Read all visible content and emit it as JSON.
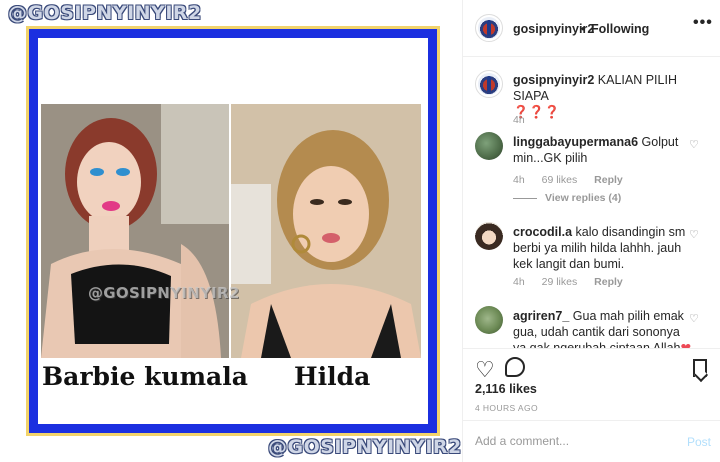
{
  "image": {
    "watermark_top": "@GOSIPNYINYIR2",
    "watermark_bottom": "@GOSIPNYINYIR2",
    "photo_watermark": "@GOSIPNYINYIR2",
    "left_label": "Barbie kumala",
    "right_label": "Hilda",
    "colors": {
      "frame_blue": "#1b2fe0",
      "frame_yellow": "#f2d36b"
    }
  },
  "header": {
    "username": "gosipnyinyir2",
    "separator": "•",
    "follow_status": "Following",
    "more_label": "•••"
  },
  "caption": {
    "username": "gosipnyinyir2",
    "text": "KALIAN PILIH SIAPA",
    "emoji": "❓❓❓",
    "time": "4h"
  },
  "comments": [
    {
      "username": "linggabayupermana6",
      "text": "Golput min...GK pilih",
      "time": "4h",
      "likes": "69 likes",
      "reply": "Reply",
      "view_replies": "View replies (4)"
    },
    {
      "username": "crocodil.a",
      "text": "kalo disandingin sm berbi ya milih hilda lahhh. jauh kek langit dan bumi.",
      "time": "4h",
      "likes": "29 likes",
      "reply": "Reply"
    },
    {
      "username": "agriren7_",
      "text": "Gua mah pilih emak gua, udah cantik dari sononya ya gak ngerubah ciptaan Allah",
      "emoji": "❤"
    }
  ],
  "actions": {
    "likes": "2,116 likes",
    "timestamp": "4 HOURS AGO"
  },
  "add_comment": {
    "placeholder": "Add a comment...",
    "post_label": "Post"
  },
  "icons": [
    "heart-icon",
    "comment-icon",
    "bookmark-icon",
    "more-icon"
  ]
}
